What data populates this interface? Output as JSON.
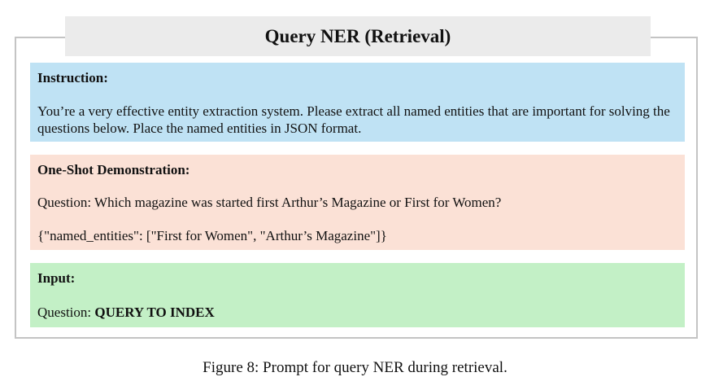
{
  "figure": {
    "title": "Query NER (Retrieval)",
    "caption": "Figure 8: Prompt for query NER during retrieval."
  },
  "instruction": {
    "heading": "Instruction:",
    "text": "You’re a very effective entity extraction system. Please extract all named entities that are important for solving the questions below. Place the named entities in JSON format."
  },
  "demonstration": {
    "heading": "One-Shot Demonstration:",
    "question": "Question: Which magazine was started first Arthur’s Magazine or First for Women?",
    "answer": "{\"named_entities\": [\"First for Women\", \"Arthur’s Magazine\"]}"
  },
  "input": {
    "heading": "Input:",
    "question_prefix": "Question: ",
    "question_value": "QUERY TO INDEX"
  }
}
